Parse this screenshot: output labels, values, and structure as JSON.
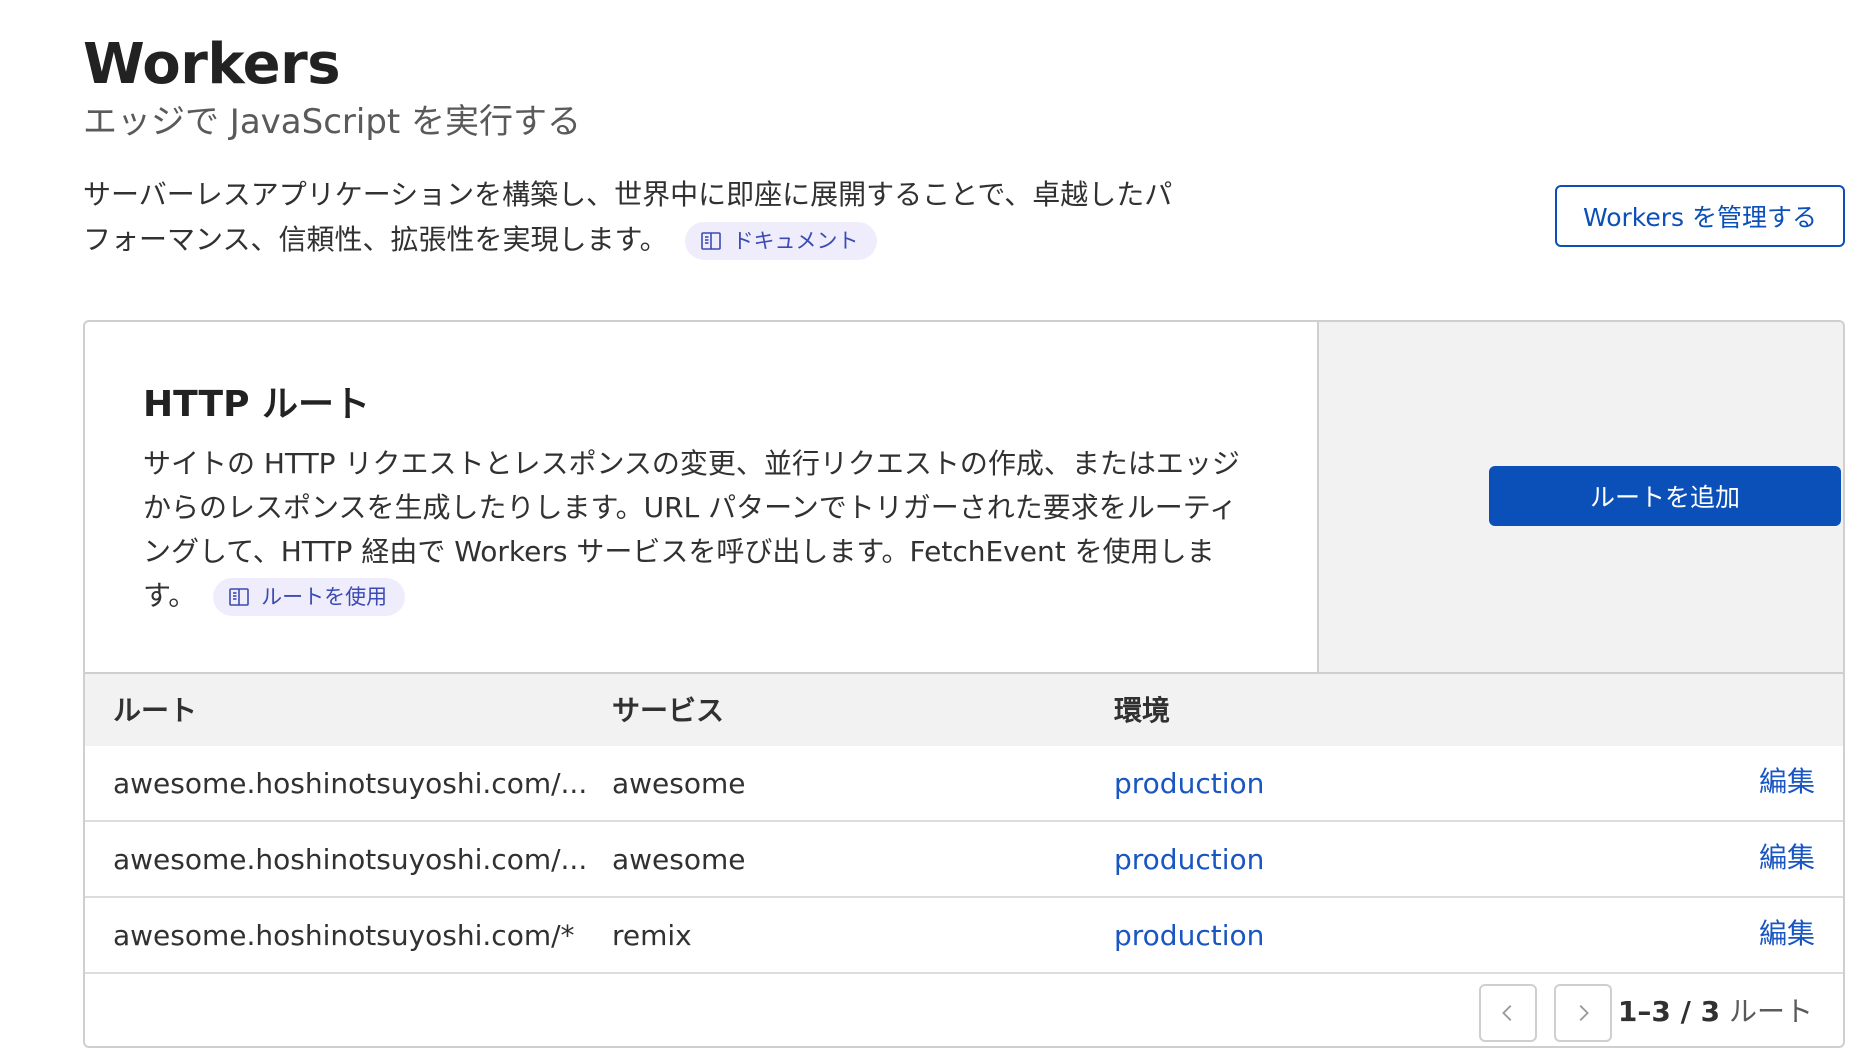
{
  "header": {
    "title": "Workers",
    "subtitle": "エッジで JavaScript を実行する",
    "description": "サーバーレスアプリケーションを構築し、世界中に即座に展開することで、卓越したパフォーマンス、信頼性、拡張性を実現します。",
    "docs_link": "ドキュメント",
    "manage_button": "Workers を管理する"
  },
  "routes_card": {
    "title": "HTTP ルート",
    "description": "サイトの HTTP リクエストとレスポンスの変更、並行リクエストの作成、またはエッジからのレスポンスを生成したりします。URL パターンでトリガーされた要求をルーティングして、HTTP 経由で Workers サービスを呼び出します。FetchEvent を使用します。",
    "docs_link": "ルートを使用",
    "add_button": "ルートを追加"
  },
  "table": {
    "columns": [
      "ルート",
      "サービス",
      "環境"
    ],
    "rows": [
      {
        "route": "awesome.hoshinotsuyoshi.com/...",
        "service": "awesome",
        "environment": "production",
        "action": "編集"
      },
      {
        "route": "awesome.hoshinotsuyoshi.com/...",
        "service": "awesome",
        "environment": "production",
        "action": "編集"
      },
      {
        "route": "awesome.hoshinotsuyoshi.com/*",
        "service": "remix",
        "environment": "production",
        "action": "編集"
      }
    ]
  },
  "pagination": {
    "range": "1–3 / 3",
    "unit": "ルート"
  },
  "colors": {
    "primary": "#0b4fb8",
    "link": "#1a56c2",
    "pill_bg": "#efedfb"
  },
  "icons": {
    "docs": "book-icon",
    "prev": "chevron-left-icon",
    "next": "chevron-right-icon"
  }
}
